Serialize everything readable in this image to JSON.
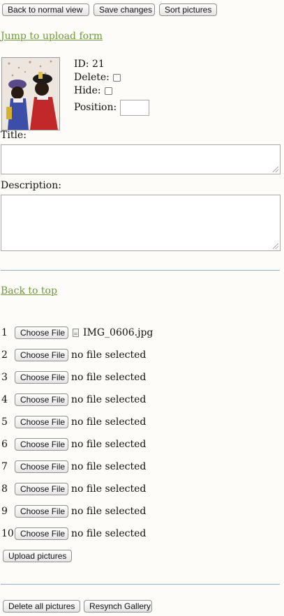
{
  "toolbar": {
    "back_label": "Back to normal view",
    "save_label": "Save changes",
    "sort_label": "Sort pictures"
  },
  "jump_link": "Jump to upload form",
  "picture": {
    "id_label": "ID:",
    "id_value": "21",
    "delete_label": "Delete:",
    "hide_label": "Hide:",
    "position_label": "Position:",
    "position_value": "",
    "title_label": "Title:",
    "title_value": "",
    "description_label": "Description:",
    "description_value": ""
  },
  "back_to_top": "Back to top",
  "upload": {
    "choose_label": "Choose File",
    "rows": [
      {
        "num": "1",
        "file": "IMG_0606.jpg"
      },
      {
        "num": "2",
        "file": "no file selected"
      },
      {
        "num": "3",
        "file": "no file selected"
      },
      {
        "num": "4",
        "file": "no file selected"
      },
      {
        "num": "5",
        "file": "no file selected"
      },
      {
        "num": "6",
        "file": "no file selected"
      },
      {
        "num": "7",
        "file": "no file selected"
      },
      {
        "num": "8",
        "file": "no file selected"
      },
      {
        "num": "9",
        "file": "no file selected"
      },
      {
        "num": "10",
        "file": "no file selected"
      }
    ],
    "upload_label": "Upload pictures"
  },
  "footer": {
    "delete_all_label": "Delete all pictures",
    "resynch_label": "Resynch Gallery"
  },
  "colors": {
    "link": "#6f9a3a",
    "rule": "#8fb0c8",
    "background": "#fdfcf8"
  }
}
